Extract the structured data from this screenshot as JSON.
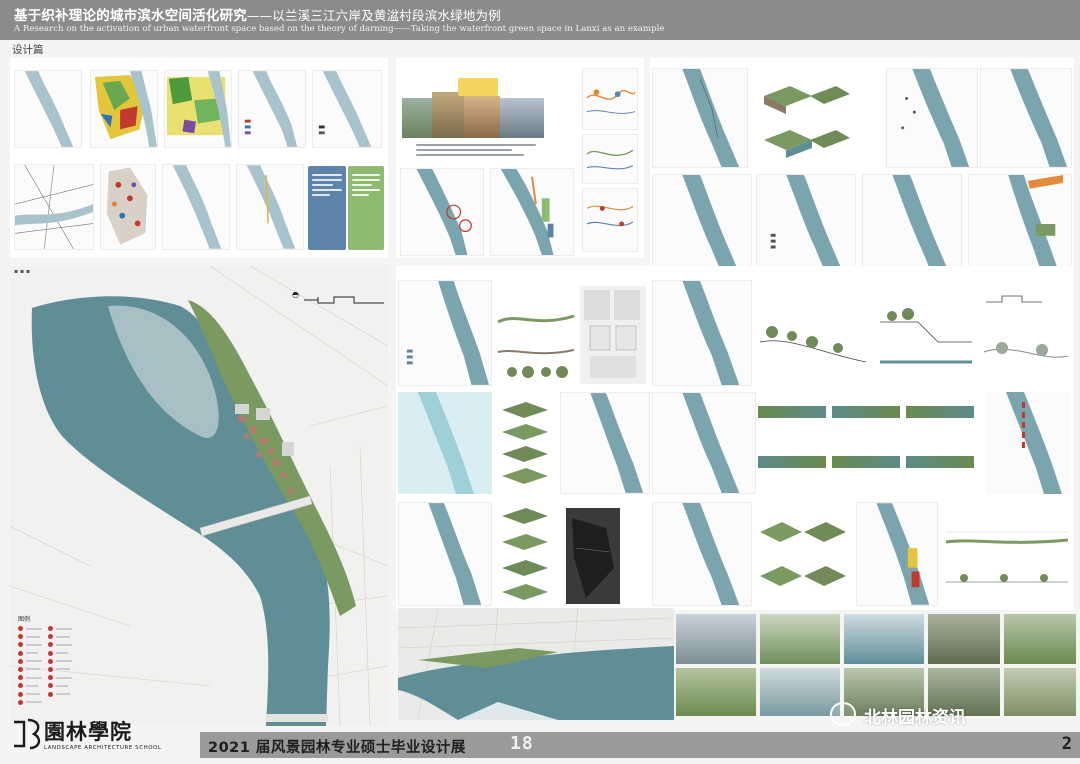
{
  "header": {
    "title_main": "基于织补理论的城市滨水空间活化研究",
    "title_sub": "——以兰溪三江六岸及黄湓村段滨水绿地为例",
    "title_en": "A Research on the activation of urban waterfront space based on the theory of darning——Taking the waterfront green space in Lanxi as an example",
    "section": "设计篇"
  },
  "master_plan": {
    "legend_title": "图例"
  },
  "footer": {
    "logo_cn": "園林學院",
    "logo_en": "LANDSCAPE ARCHITECTURE SCHOOL",
    "exhibition": "2021 届风景园林专业硕士毕业设计展",
    "board_number": "18",
    "page_number": "2"
  },
  "watermark": {
    "text": "北林园林资讯"
  },
  "colors": {
    "header_bg": "#8b8b8b",
    "river": "#5f8e97",
    "river_light": "#d7e4ea",
    "greenery": "#7a9a62",
    "footer_bar": "#9a9a9a",
    "legend_red": "#c0392b"
  }
}
